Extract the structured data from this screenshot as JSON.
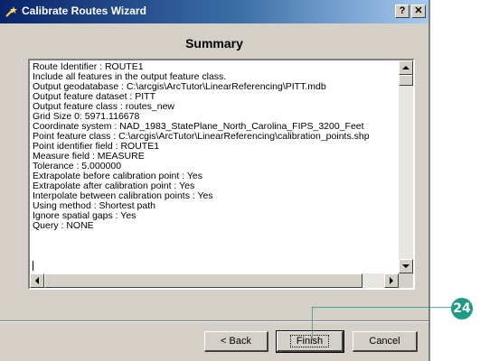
{
  "window": {
    "title": "Calibrate Routes Wizard",
    "help_label": "?",
    "close_label": "✕"
  },
  "heading": "Summary",
  "summary_lines": [
    "Route Identifier : ROUTE1",
    "Include all features in the output feature class.",
    "Output geodatabase : C:\\arcgis\\ArcTutor\\LinearReferencing\\PITT.mdb",
    "Output feature dataset : PITT",
    "Output feature class : routes_new",
    "Grid Size 0: 5971.116678",
    "Coordinate system : NAD_1983_StatePlane_North_Carolina_FIPS_3200_Feet",
    "Point feature class : C:\\arcgis\\ArcTutor\\LinearReferencing\\calibration_points.shp",
    "Point identifier field : ROUTE1",
    "Measure field : MEASURE",
    "Tolerance : 5.000000",
    "Extrapolate before calibration point : Yes",
    "Extrapolate after calibration point : Yes",
    "Interpolate between calibration points : Yes",
    "Using method : Shortest path",
    "Ignore spatial gaps : Yes",
    "Query : NONE"
  ],
  "buttons": {
    "back": "< Back",
    "finish": "Finish",
    "cancel": "Cancel"
  },
  "callout": {
    "number": "24",
    "color": "#1e9a85"
  },
  "colors": {
    "title_bar": "#0a246a",
    "dialog_face": "#d4d0c8"
  }
}
